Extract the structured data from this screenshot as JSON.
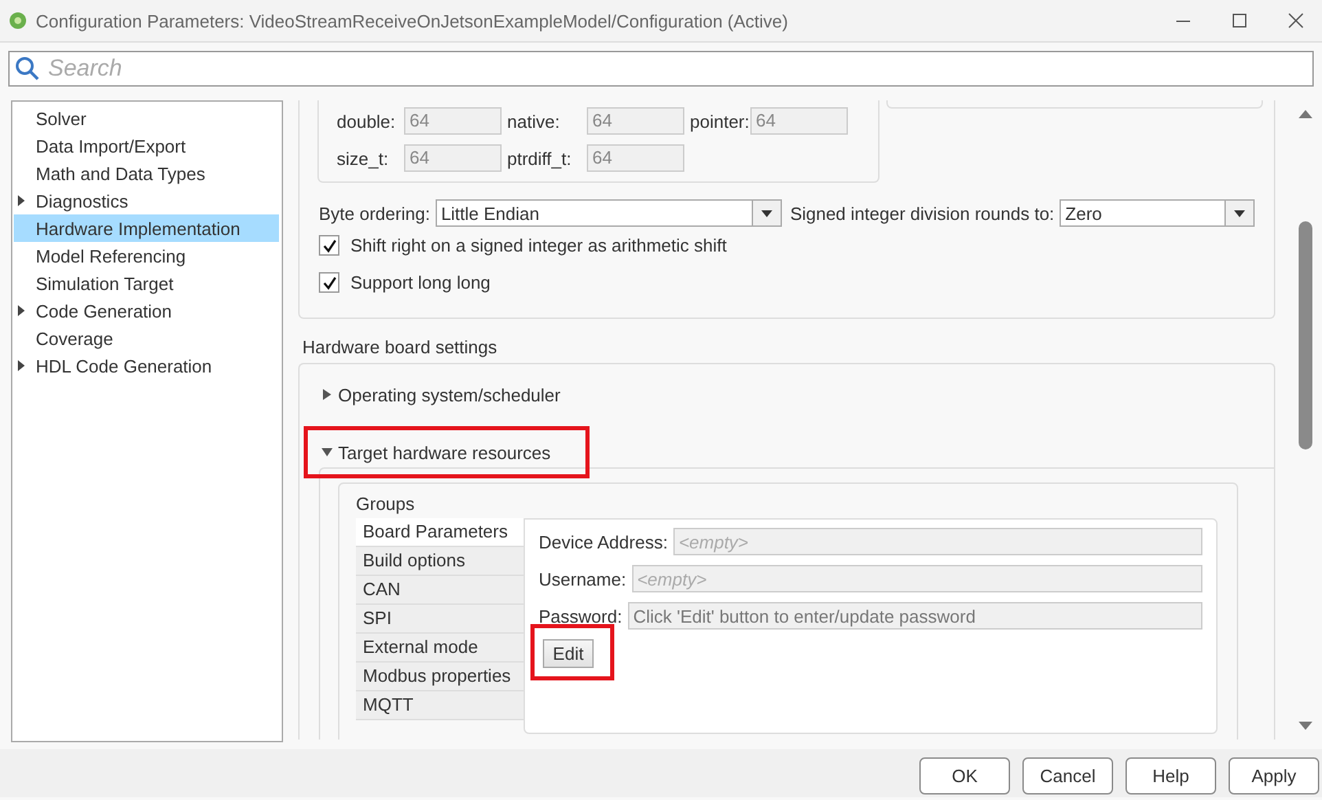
{
  "window": {
    "title": "Configuration Parameters: VideoStreamReceiveOnJetsonExampleModel/Configuration (Active)"
  },
  "search": {
    "placeholder": "Search"
  },
  "tree": {
    "items": [
      {
        "label": "Solver",
        "kind": "page",
        "selected": false
      },
      {
        "label": "Data Import/Export",
        "kind": "page",
        "selected": false
      },
      {
        "label": "Math and Data Types",
        "kind": "page",
        "selected": false
      },
      {
        "label": "Diagnostics",
        "kind": "group",
        "expanded": false,
        "selected": false
      },
      {
        "label": "Hardware Implementation",
        "kind": "page",
        "selected": true
      },
      {
        "label": "Model Referencing",
        "kind": "page",
        "selected": false
      },
      {
        "label": "Simulation Target",
        "kind": "page",
        "selected": false
      },
      {
        "label": "Code Generation",
        "kind": "group",
        "expanded": false,
        "selected": false
      },
      {
        "label": "Coverage",
        "kind": "page",
        "selected": false
      },
      {
        "label": "HDL Code Generation",
        "kind": "group",
        "expanded": false,
        "selected": false
      }
    ]
  },
  "device_sizes": {
    "fields": [
      {
        "label": "double:",
        "value": "64"
      },
      {
        "label": "native:",
        "value": "64"
      },
      {
        "label": "pointer:",
        "value": "64"
      },
      {
        "label": "size_t:",
        "value": "64"
      },
      {
        "label": "ptrdiff_t:",
        "value": "64"
      }
    ]
  },
  "byte_ordering": {
    "label": "Byte ordering:",
    "value": "Little Endian"
  },
  "division_rounding": {
    "label": "Signed integer division rounds to:",
    "value": "Zero"
  },
  "checkboxes": [
    {
      "label": "Shift right on a signed integer as arithmetic shift",
      "checked": true
    },
    {
      "label": "Support long long",
      "checked": true
    }
  ],
  "hardware_board_settings": {
    "heading": "Hardware board settings",
    "sections": [
      {
        "label": "Operating system/scheduler",
        "expanded": false,
        "highlighted": false
      },
      {
        "label": "Target hardware resources",
        "expanded": true,
        "highlighted": true,
        "groups": {
          "heading": "Groups",
          "items": [
            {
              "label": "Board Parameters",
              "selected": true
            },
            {
              "label": "Build options",
              "selected": false
            },
            {
              "label": "CAN",
              "selected": false
            },
            {
              "label": "SPI",
              "selected": false
            },
            {
              "label": "External mode",
              "selected": false
            },
            {
              "label": "Modbus properties",
              "selected": false
            },
            {
              "label": "MQTT",
              "selected": false
            }
          ]
        },
        "board_parameters": {
          "fields": [
            {
              "label": "Device Address:",
              "placeholder": "<empty>"
            },
            {
              "label": "Username:",
              "placeholder": "<empty>"
            },
            {
              "label": "Password:",
              "value": "Click 'Edit' button to enter/update password"
            }
          ],
          "edit_button": {
            "label": "Edit",
            "highlighted": true
          }
        }
      }
    ]
  },
  "buttons": [
    "OK",
    "Cancel",
    "Help",
    "Apply"
  ]
}
